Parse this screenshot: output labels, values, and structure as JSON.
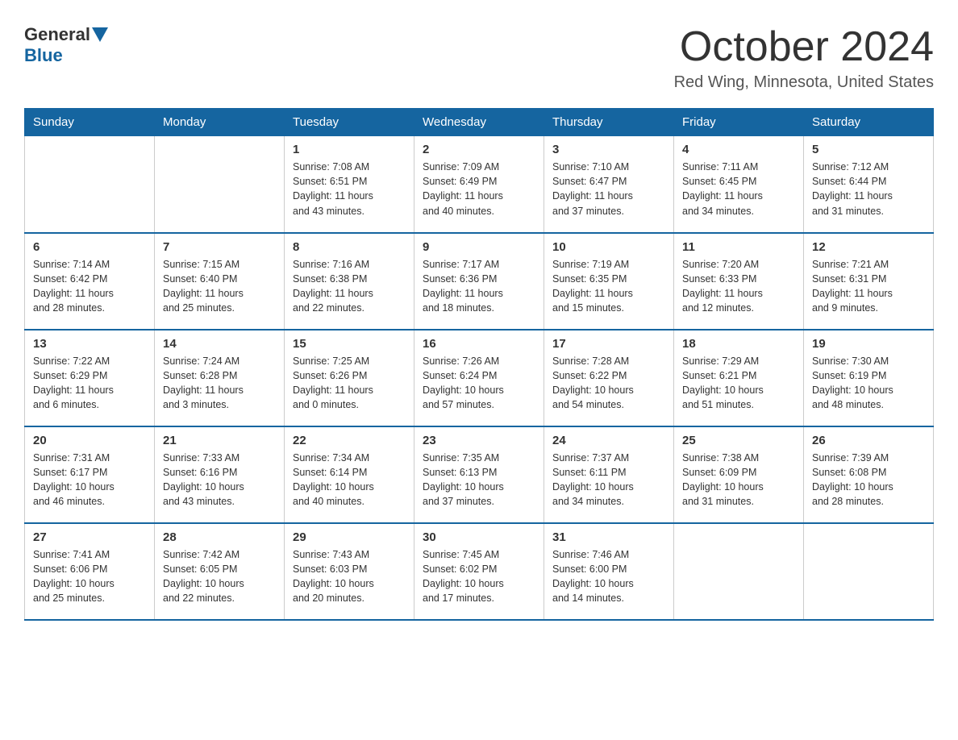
{
  "header": {
    "logo_general": "General",
    "logo_blue": "Blue",
    "month_title": "October 2024",
    "location": "Red Wing, Minnesota, United States"
  },
  "days_of_week": [
    "Sunday",
    "Monday",
    "Tuesday",
    "Wednesday",
    "Thursday",
    "Friday",
    "Saturday"
  ],
  "weeks": [
    [
      {
        "day": "",
        "info": ""
      },
      {
        "day": "",
        "info": ""
      },
      {
        "day": "1",
        "info": "Sunrise: 7:08 AM\nSunset: 6:51 PM\nDaylight: 11 hours\nand 43 minutes."
      },
      {
        "day": "2",
        "info": "Sunrise: 7:09 AM\nSunset: 6:49 PM\nDaylight: 11 hours\nand 40 minutes."
      },
      {
        "day": "3",
        "info": "Sunrise: 7:10 AM\nSunset: 6:47 PM\nDaylight: 11 hours\nand 37 minutes."
      },
      {
        "day": "4",
        "info": "Sunrise: 7:11 AM\nSunset: 6:45 PM\nDaylight: 11 hours\nand 34 minutes."
      },
      {
        "day": "5",
        "info": "Sunrise: 7:12 AM\nSunset: 6:44 PM\nDaylight: 11 hours\nand 31 minutes."
      }
    ],
    [
      {
        "day": "6",
        "info": "Sunrise: 7:14 AM\nSunset: 6:42 PM\nDaylight: 11 hours\nand 28 minutes."
      },
      {
        "day": "7",
        "info": "Sunrise: 7:15 AM\nSunset: 6:40 PM\nDaylight: 11 hours\nand 25 minutes."
      },
      {
        "day": "8",
        "info": "Sunrise: 7:16 AM\nSunset: 6:38 PM\nDaylight: 11 hours\nand 22 minutes."
      },
      {
        "day": "9",
        "info": "Sunrise: 7:17 AM\nSunset: 6:36 PM\nDaylight: 11 hours\nand 18 minutes."
      },
      {
        "day": "10",
        "info": "Sunrise: 7:19 AM\nSunset: 6:35 PM\nDaylight: 11 hours\nand 15 minutes."
      },
      {
        "day": "11",
        "info": "Sunrise: 7:20 AM\nSunset: 6:33 PM\nDaylight: 11 hours\nand 12 minutes."
      },
      {
        "day": "12",
        "info": "Sunrise: 7:21 AM\nSunset: 6:31 PM\nDaylight: 11 hours\nand 9 minutes."
      }
    ],
    [
      {
        "day": "13",
        "info": "Sunrise: 7:22 AM\nSunset: 6:29 PM\nDaylight: 11 hours\nand 6 minutes."
      },
      {
        "day": "14",
        "info": "Sunrise: 7:24 AM\nSunset: 6:28 PM\nDaylight: 11 hours\nand 3 minutes."
      },
      {
        "day": "15",
        "info": "Sunrise: 7:25 AM\nSunset: 6:26 PM\nDaylight: 11 hours\nand 0 minutes."
      },
      {
        "day": "16",
        "info": "Sunrise: 7:26 AM\nSunset: 6:24 PM\nDaylight: 10 hours\nand 57 minutes."
      },
      {
        "day": "17",
        "info": "Sunrise: 7:28 AM\nSunset: 6:22 PM\nDaylight: 10 hours\nand 54 minutes."
      },
      {
        "day": "18",
        "info": "Sunrise: 7:29 AM\nSunset: 6:21 PM\nDaylight: 10 hours\nand 51 minutes."
      },
      {
        "day": "19",
        "info": "Sunrise: 7:30 AM\nSunset: 6:19 PM\nDaylight: 10 hours\nand 48 minutes."
      }
    ],
    [
      {
        "day": "20",
        "info": "Sunrise: 7:31 AM\nSunset: 6:17 PM\nDaylight: 10 hours\nand 46 minutes."
      },
      {
        "day": "21",
        "info": "Sunrise: 7:33 AM\nSunset: 6:16 PM\nDaylight: 10 hours\nand 43 minutes."
      },
      {
        "day": "22",
        "info": "Sunrise: 7:34 AM\nSunset: 6:14 PM\nDaylight: 10 hours\nand 40 minutes."
      },
      {
        "day": "23",
        "info": "Sunrise: 7:35 AM\nSunset: 6:13 PM\nDaylight: 10 hours\nand 37 minutes."
      },
      {
        "day": "24",
        "info": "Sunrise: 7:37 AM\nSunset: 6:11 PM\nDaylight: 10 hours\nand 34 minutes."
      },
      {
        "day": "25",
        "info": "Sunrise: 7:38 AM\nSunset: 6:09 PM\nDaylight: 10 hours\nand 31 minutes."
      },
      {
        "day": "26",
        "info": "Sunrise: 7:39 AM\nSunset: 6:08 PM\nDaylight: 10 hours\nand 28 minutes."
      }
    ],
    [
      {
        "day": "27",
        "info": "Sunrise: 7:41 AM\nSunset: 6:06 PM\nDaylight: 10 hours\nand 25 minutes."
      },
      {
        "day": "28",
        "info": "Sunrise: 7:42 AM\nSunset: 6:05 PM\nDaylight: 10 hours\nand 22 minutes."
      },
      {
        "day": "29",
        "info": "Sunrise: 7:43 AM\nSunset: 6:03 PM\nDaylight: 10 hours\nand 20 minutes."
      },
      {
        "day": "30",
        "info": "Sunrise: 7:45 AM\nSunset: 6:02 PM\nDaylight: 10 hours\nand 17 minutes."
      },
      {
        "day": "31",
        "info": "Sunrise: 7:46 AM\nSunset: 6:00 PM\nDaylight: 10 hours\nand 14 minutes."
      },
      {
        "day": "",
        "info": ""
      },
      {
        "day": "",
        "info": ""
      }
    ]
  ]
}
